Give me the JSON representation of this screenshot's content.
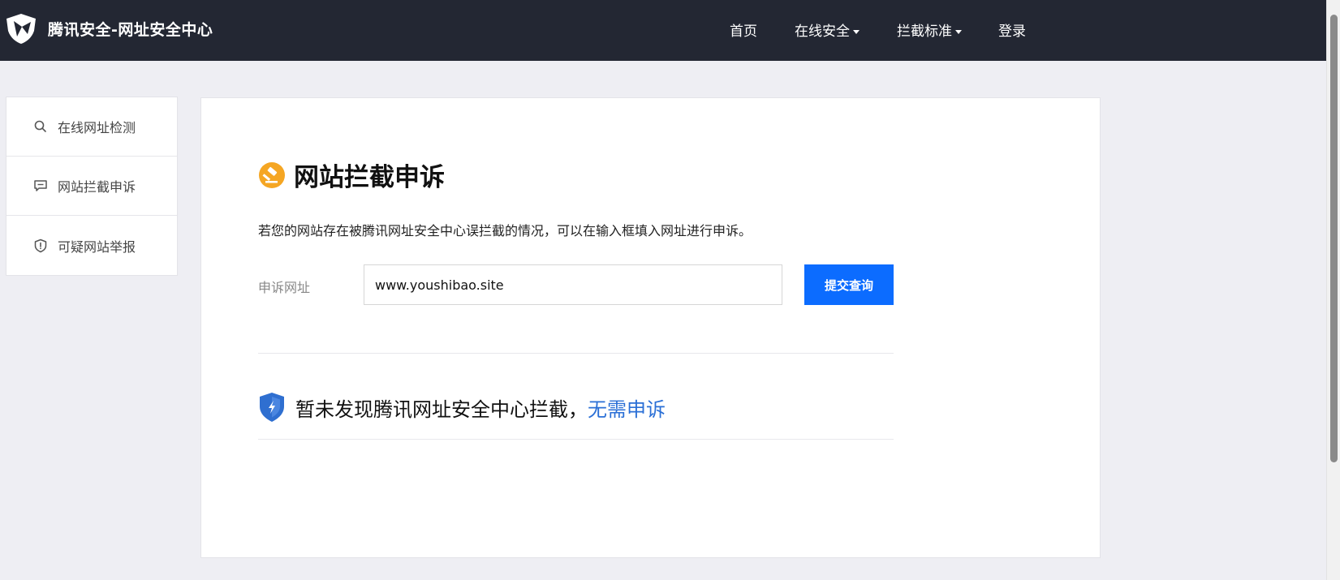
{
  "header": {
    "title": "腾讯安全-网址安全中心",
    "nav": [
      {
        "label": "首页",
        "has_dropdown": false
      },
      {
        "label": "在线安全",
        "has_dropdown": true
      },
      {
        "label": "拦截标准",
        "has_dropdown": true
      },
      {
        "label": "登录",
        "has_dropdown": false
      }
    ]
  },
  "sidebar": {
    "items": [
      {
        "label": "在线网址检测",
        "icon": "search-icon"
      },
      {
        "label": "网站拦截申诉",
        "icon": "message-icon"
      },
      {
        "label": "可疑网站举报",
        "icon": "shield-alert-icon"
      }
    ]
  },
  "main": {
    "heading": "网站拦截申诉",
    "description": "若您的网站存在被腾讯网址安全中心误拦截的情况，可以在输入框填入网址进行申诉。",
    "field_label": "申诉网址",
    "url_value": "www.youshibao.site",
    "submit_label": "提交查询",
    "result_text": "暂未发现腾讯网址安全中心拦截，",
    "result_link": "无需申诉"
  },
  "colors": {
    "topbar": "#232733",
    "accent": "#0c6cff",
    "link": "#2a6fd6",
    "heading_icon": "#f5a623",
    "shield": "#2f6fd0"
  }
}
